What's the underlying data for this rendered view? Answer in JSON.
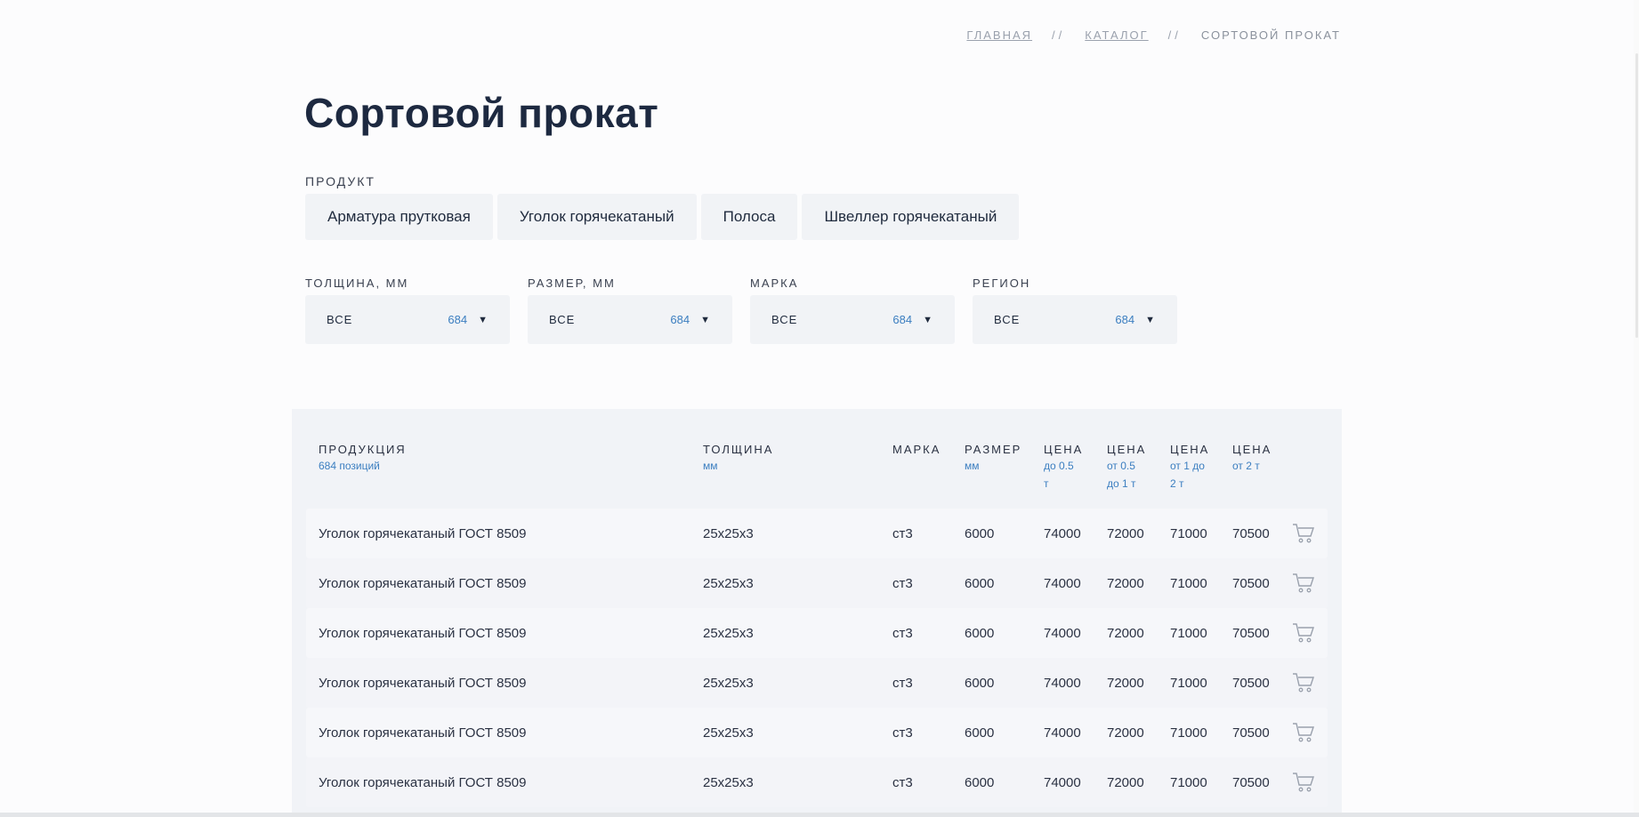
{
  "breadcrumb": {
    "home": "Главная",
    "catalog": "Каталог",
    "separator": "//",
    "current": "Сортовой прокат"
  },
  "page_title": "Сортовой прокат",
  "product_filter": {
    "label": "Продукт",
    "chips": [
      "Арматура прутковая",
      "Уголок горячекатаный",
      "Полоса",
      "Швеллер горячекатаный"
    ]
  },
  "filters": [
    {
      "label": "Толщина, мм",
      "value": "ВСЕ",
      "count": "684"
    },
    {
      "label": "Размер, мм",
      "value": "ВСЕ",
      "count": "684"
    },
    {
      "label": "Марка",
      "value": "ВСЕ",
      "count": "684"
    },
    {
      "label": "Регион",
      "value": "ВСЕ",
      "count": "684"
    }
  ],
  "table": {
    "headers": {
      "product": {
        "title": "Продукция",
        "sub": "684 позиций"
      },
      "thickness": {
        "title": "Толщина",
        "sub": "мм"
      },
      "grade": {
        "title": "Марка",
        "sub": ""
      },
      "size": {
        "title": "Размер",
        "sub": "мм"
      },
      "price1": {
        "title": "Цена",
        "sub1": "до 0.5",
        "sub2": "т"
      },
      "price2": {
        "title": "Цена",
        "sub1": "от 0.5",
        "sub2": "до 1 т"
      },
      "price3": {
        "title": "Цена",
        "sub1": "от 1 до",
        "sub2": "2 т"
      },
      "price4": {
        "title": "Цена",
        "sub1": "от 2 т",
        "sub2": ""
      }
    },
    "rows": [
      {
        "name": "Уголок горячекатаный ГОСТ 8509",
        "thickness": "25x25x3",
        "grade": "ст3",
        "size": "6000",
        "p1": "74000",
        "p2": "72000",
        "p3": "71000",
        "p4": "70500"
      },
      {
        "name": "Уголок горячекатаный ГОСТ 8509",
        "thickness": "25x25x3",
        "grade": "ст3",
        "size": "6000",
        "p1": "74000",
        "p2": "72000",
        "p3": "71000",
        "p4": "70500"
      },
      {
        "name": "Уголок горячекатаный ГОСТ 8509",
        "thickness": "25x25x3",
        "grade": "ст3",
        "size": "6000",
        "p1": "74000",
        "p2": "72000",
        "p3": "71000",
        "p4": "70500"
      },
      {
        "name": "Уголок горячекатаный ГОСТ 8509",
        "thickness": "25x25x3",
        "grade": "ст3",
        "size": "6000",
        "p1": "74000",
        "p2": "72000",
        "p3": "71000",
        "p4": "70500"
      },
      {
        "name": "Уголок горячекатаный ГОСТ 8509",
        "thickness": "25x25x3",
        "grade": "ст3",
        "size": "6000",
        "p1": "74000",
        "p2": "72000",
        "p3": "71000",
        "p4": "70500"
      },
      {
        "name": "Уголок горячекатаный ГОСТ 8509",
        "thickness": "25x25x3",
        "grade": "ст3",
        "size": "6000",
        "p1": "74000",
        "p2": "72000",
        "p3": "71000",
        "p4": "70500"
      }
    ],
    "row_icon": "cart-icon"
  },
  "colors": {
    "accent": "#3b7ec0",
    "title": "#1d2940",
    "panel": "#f1f3f7"
  }
}
